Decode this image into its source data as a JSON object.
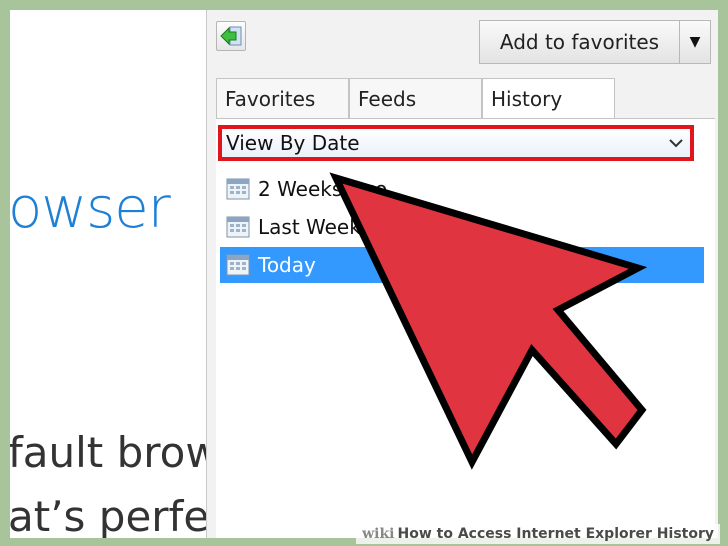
{
  "background_page": {
    "heading_fragment": "owser",
    "line1_fragment": "fault brows",
    "line2_fragment": "at’s perfec"
  },
  "panel": {
    "back_button_icon": "green-back-arrow-icon",
    "add_favorites_label": "Add to favorites",
    "tabs": [
      {
        "label": "Favorites",
        "active": false
      },
      {
        "label": "Feeds",
        "active": false
      },
      {
        "label": "History",
        "active": true
      }
    ],
    "view_dropdown": {
      "selected": "View By Date",
      "highlight_color": "#e0161e"
    },
    "history_items": [
      {
        "label": "2 Weeks Ago",
        "selected": false
      },
      {
        "label": "Last Week",
        "selected": false
      },
      {
        "label": "Today",
        "selected": true
      }
    ]
  },
  "overlay": {
    "pointer": "red-arrow-pointer",
    "color": "#e03540"
  },
  "caption": {
    "brand": "wiki",
    "title": "How to Access Internet Explorer History"
  }
}
